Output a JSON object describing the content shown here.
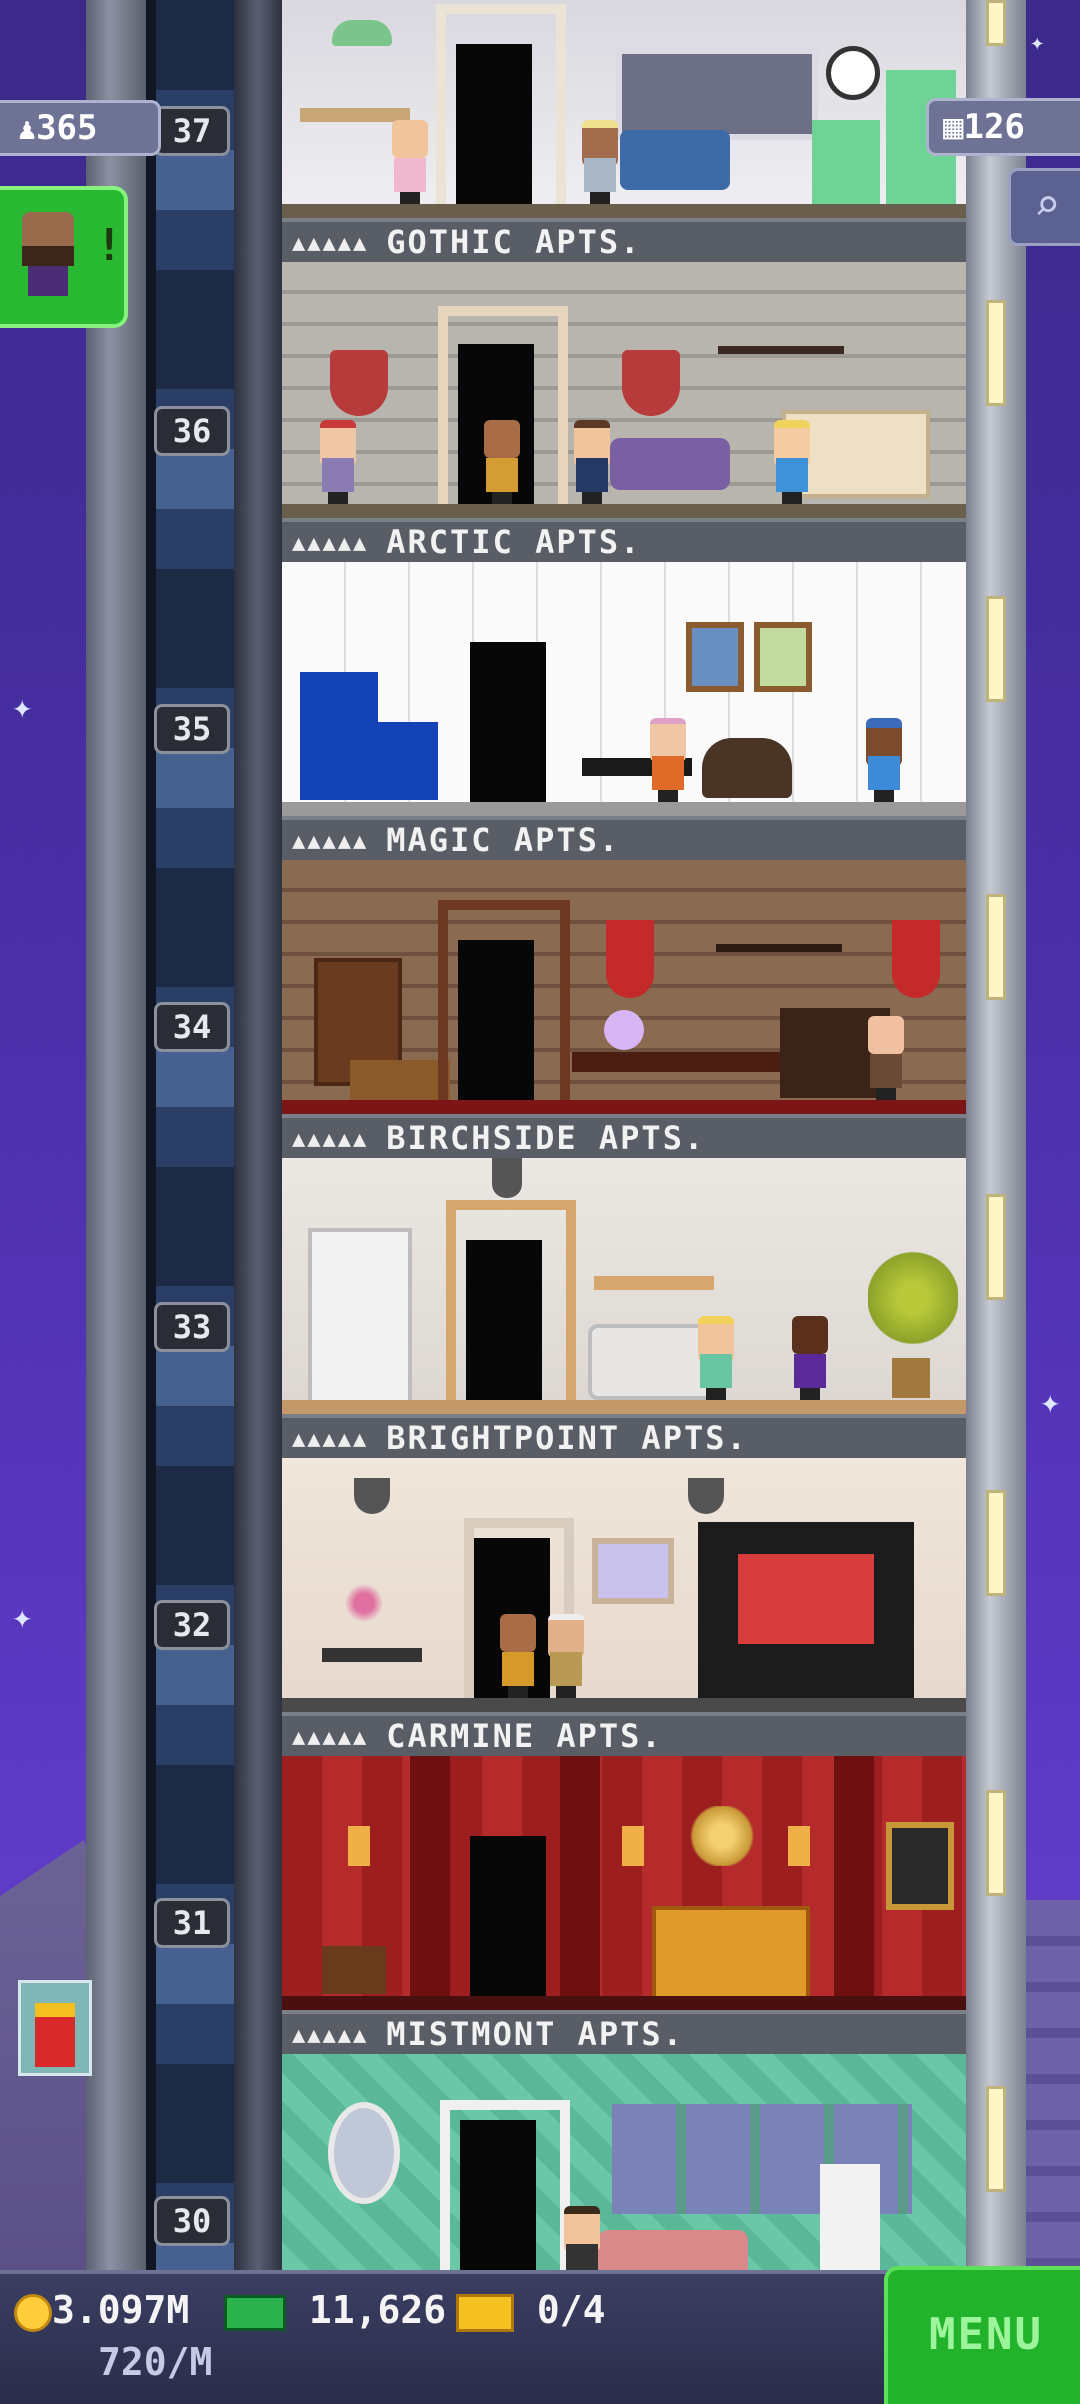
{
  "hud": {
    "population": "365",
    "floors_count": "126",
    "population_icon": "person-icon",
    "floors_icon": "building-icon"
  },
  "floors": [
    {
      "number": "37",
      "name": "GOTHIC APTS.",
      "stars": "▲▲▲▲▲"
    },
    {
      "number": "36",
      "name": "ARCTIC APTS.",
      "stars": "▲▲▲▲▲"
    },
    {
      "number": "35",
      "name": "MAGIC APTS.",
      "stars": "▲▲▲▲▲"
    },
    {
      "number": "34",
      "name": "BIRCHSIDE APTS.",
      "stars": "▲▲▲▲▲"
    },
    {
      "number": "33",
      "name": "BRIGHTPOINT APTS.",
      "stars": "▲▲▲▲▲"
    },
    {
      "number": "32",
      "name": "CARMINE APTS.",
      "stars": "▲▲▲▲▲"
    },
    {
      "number": "31",
      "name": "MISTMONT APTS.",
      "stars": "▲▲▲▲▲"
    },
    {
      "number": "30",
      "name": "",
      "stars": ""
    }
  ],
  "vip": {
    "indicator": "!"
  },
  "bottom": {
    "coins": "3.097M",
    "coin_rate": "720/M",
    "bux": "11,626",
    "tickets": "0/4",
    "menu_label": "MENU"
  },
  "colors": {
    "sky": "#4a2fa8",
    "menu_green": "#22b22c",
    "hud_panel": "#6e7396"
  }
}
